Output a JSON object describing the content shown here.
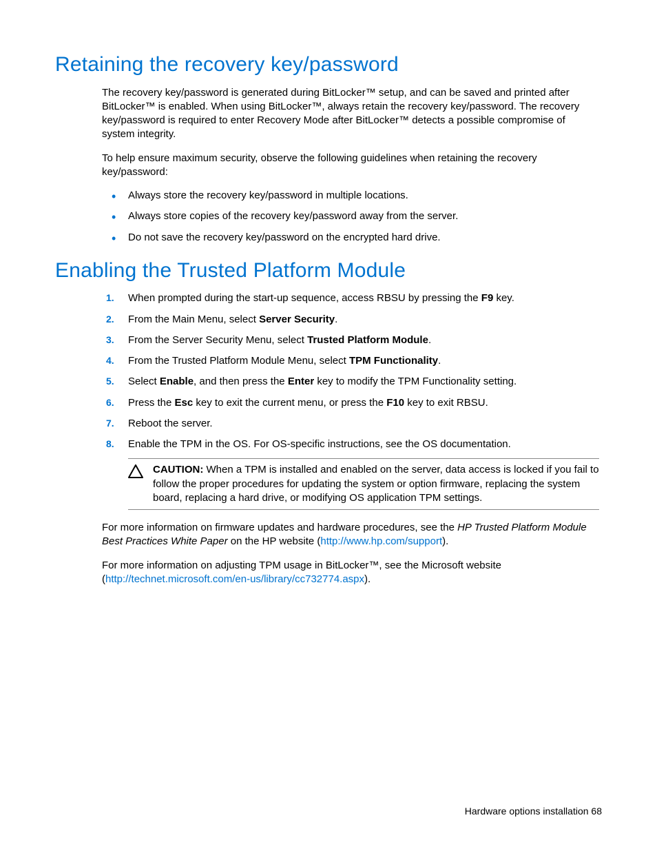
{
  "section1": {
    "heading": "Retaining the recovery key/password",
    "p1": "The recovery key/password is generated during BitLocker™ setup, and can be saved and printed after BitLocker™ is enabled. When using BitLocker™, always retain the recovery key/password. The recovery key/password is required to enter Recovery Mode after BitLocker™ detects a possible compromise of system integrity.",
    "p2": "To help ensure maximum security, observe the following guidelines when retaining the recovery key/password:",
    "bullets": {
      "b1": "Always store the recovery key/password in multiple locations.",
      "b2": "Always store copies of the recovery key/password away from the server.",
      "b3": "Do not save the recovery key/password on the encrypted hard drive."
    }
  },
  "section2": {
    "heading": "Enabling the Trusted Platform Module",
    "step1_a": "When prompted during the start-up sequence, access RBSU by pressing the ",
    "step1_b": "F9",
    "step1_c": " key.",
    "step2_a": "From the Main Menu, select ",
    "step2_b": "Server Security",
    "step2_c": ".",
    "step3_a": "From the Server Security Menu, select ",
    "step3_b": "Trusted Platform Module",
    "step3_c": ".",
    "step4_a": "From the Trusted Platform Module Menu, select ",
    "step4_b": "TPM Functionality",
    "step4_c": ".",
    "step5_a": "Select ",
    "step5_b": "Enable",
    "step5_c": ", and then press the ",
    "step5_d": "Enter",
    "step5_e": " key to modify the TPM Functionality setting.",
    "step6_a": "Press the ",
    "step6_b": "Esc",
    "step6_c": " key to exit the current menu, or press the ",
    "step6_d": "F10",
    "step6_e": " key to exit RBSU.",
    "step7": "Reboot the server.",
    "step8": "Enable the TPM in the OS. For OS-specific instructions, see the OS documentation.",
    "caution_label": "CAUTION:",
    "caution_text": "   When a TPM is installed and enabled on the server, data access is locked if you fail to follow the proper procedures for updating the system or option firmware, replacing the system board, replacing a hard drive, or modifying OS application TPM settings.",
    "p_fw_a": "For more information on firmware updates and hardware procedures, see the ",
    "p_fw_b": "HP Trusted Platform Module Best Practices White Paper",
    "p_fw_c": " on the HP website (",
    "p_fw_link": "http://www.hp.com/support",
    "p_fw_d": ").",
    "p_ms_a": "For more information on adjusting TPM usage in BitLocker™, see the Microsoft website (",
    "p_ms_link": "http://technet.microsoft.com/en-us/library/cc732774.aspx",
    "p_ms_b": ")."
  },
  "footer": {
    "text": "Hardware options installation   68"
  }
}
